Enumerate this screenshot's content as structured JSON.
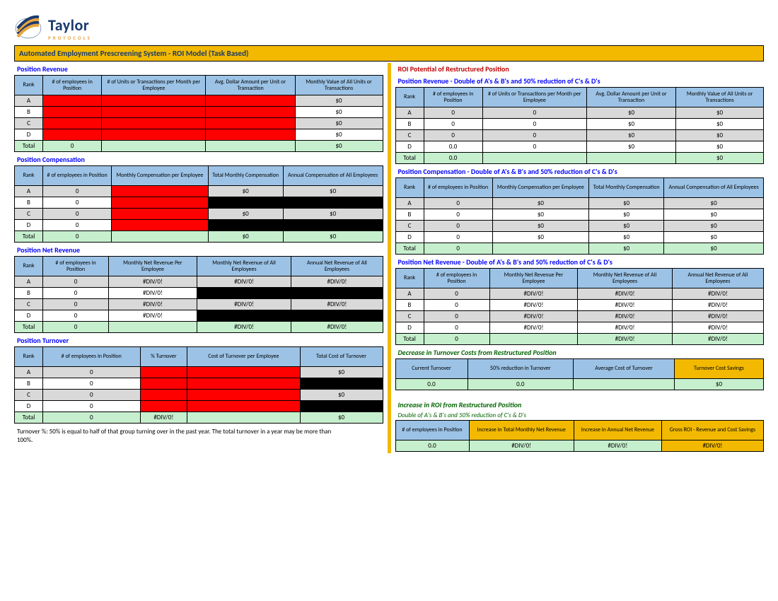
{
  "logo": {
    "name": "Taylor",
    "sub": "PROTOCOLS"
  },
  "title_bar": "Automated Employment Prescreening System - ROI Model (Task Based)",
  "ranks": [
    "A",
    "B",
    "C",
    "D"
  ],
  "total_label": "Total",
  "note": "Turnover %: 50% is equal to half of that group turning over in the past year. The total turnover in a year may be more than 100%.",
  "left": {
    "sec1": {
      "title": "Position Revenue",
      "headers": [
        "Rank",
        "# of employees in Position",
        "# of Units or Transactions per Month per Employee",
        "Avg. Dollar Amount per Unit or Transaction",
        "Monthly Value of All Units or Transactions"
      ],
      "rows": [
        [
          "A",
          "",
          "",
          "",
          "$0"
        ],
        [
          "B",
          "",
          "",
          "",
          "$0"
        ],
        [
          "C",
          "",
          "",
          "",
          "$0"
        ],
        [
          "D",
          "",
          "",
          "",
          "$0"
        ]
      ],
      "total": [
        "Total",
        "0",
        "",
        "",
        "$0"
      ]
    },
    "sec2": {
      "title": "Position Compensation",
      "headers": [
        "Rank",
        "# of employees in Position",
        "Monthly Compensation per Employee",
        "Total Monthly Compensation",
        "Annual Compensation of All Employees"
      ],
      "rows": [
        [
          "A",
          "0",
          "",
          "$0",
          "$0"
        ],
        [
          "B",
          "0",
          "",
          "",
          ""
        ],
        [
          "C",
          "0",
          "",
          "$0",
          "$0"
        ],
        [
          "D",
          "0",
          "",
          "",
          ""
        ]
      ],
      "total": [
        "Total",
        "0",
        "",
        "$0",
        "$0"
      ]
    },
    "sec3": {
      "title": "Position Net Revenue",
      "headers": [
        "Rank",
        "# of employees in Position",
        "Monthly Net Revenue Per Employee",
        "Monthly Net Revenue of All Employees",
        "Annual Net Revenue of All Employees"
      ],
      "rows": [
        [
          "A",
          "0",
          "#DIV/0!",
          "#DIV/0!",
          "#DIV/0!"
        ],
        [
          "B",
          "0",
          "#DIV/0!",
          "",
          ""
        ],
        [
          "C",
          "0",
          "#DIV/0!",
          "#DIV/0!",
          "#DIV/0!"
        ],
        [
          "D",
          "0",
          "#DIV/0!",
          "",
          ""
        ]
      ],
      "total": [
        "Total",
        "0",
        "",
        "#DIV/0!",
        "#DIV/0!"
      ]
    },
    "sec4": {
      "title": "Position Turnover",
      "headers": [
        "Rank",
        "# of employees in Position",
        "% Turnover",
        "Cost of Turnover per Employee",
        "Total Cost of Turnover"
      ],
      "rows": [
        [
          "A",
          "0",
          "",
          "",
          "$0"
        ],
        [
          "B",
          "0",
          "",
          "",
          ""
        ],
        [
          "C",
          "0",
          "",
          "",
          "$0"
        ],
        [
          "D",
          "0",
          "",
          "",
          ""
        ]
      ],
      "total": [
        "Total",
        "0",
        "#DIV/0!",
        "",
        "$0"
      ]
    }
  },
  "right": {
    "main_title": "ROI Potential of Restructured Position",
    "sec1": {
      "title": "Position Revenue - Double of A's & B's and 50% reduction of C's & D's",
      "headers": [
        "Rank",
        "# of employees in Position",
        "# of Units or Transactions per Month per Employee",
        "Avg. Dollar Amount per Unit or Transaction",
        "Monthly Value of All Units or Transactions"
      ],
      "rows": [
        [
          "A",
          "0",
          "0",
          "$0",
          "$0"
        ],
        [
          "B",
          "0",
          "0",
          "$0",
          "$0"
        ],
        [
          "C",
          "0",
          "0",
          "$0",
          "$0"
        ],
        [
          "D",
          "0.0",
          "0",
          "$0",
          "$0"
        ]
      ],
      "total": [
        "Total",
        "0.0",
        "",
        "",
        "$0"
      ]
    },
    "sec2": {
      "title": "Position Compensation - Double of A's & B's and 50% reduction of C's & D's",
      "headers": [
        "Rank",
        "# of employees in Position",
        "Monthly Compensation per Employee",
        "Total Monthly Compensation",
        "Annual Compensation of All Employees"
      ],
      "rows": [
        [
          "A",
          "0",
          "$0",
          "$0",
          "$0"
        ],
        [
          "B",
          "0",
          "$0",
          "$0",
          "$0"
        ],
        [
          "C",
          "0",
          "$0",
          "$0",
          "$0"
        ],
        [
          "D",
          "0",
          "$0",
          "$0",
          "$0"
        ]
      ],
      "total": [
        "Total",
        "0",
        "",
        "$0",
        "$0"
      ]
    },
    "sec3": {
      "title": "Position Net Revenue - Double of A's & B's and 50% reduction of C's & D's",
      "headers": [
        "Rank",
        "# of employees in Position",
        "Monthly Net Revenue Per Employee",
        "Monthly Net Revenue of All Employees",
        "Annual Net Revenue of All Employees"
      ],
      "rows": [
        [
          "A",
          "0",
          "#DIV/0!",
          "#DIV/0!",
          "#DIV/0!"
        ],
        [
          "B",
          "0",
          "#DIV/0!",
          "#DIV/0!",
          "#DIV/0!"
        ],
        [
          "C",
          "0",
          "#DIV/0!",
          "#DIV/0!",
          "#DIV/0!"
        ],
        [
          "D",
          "0",
          "#DIV/0!",
          "#DIV/0!",
          "#DIV/0!"
        ]
      ],
      "total": [
        "Total",
        "0",
        "",
        "#DIV/0!",
        "#DIV/0!"
      ]
    },
    "sec4": {
      "title": "Decrease in Turnover Costs from Restructured Position",
      "headers": [
        "Current Turnover",
        "50% reduction in Turnover",
        "Average Cost of Turnover",
        "Turnover Cost Savings"
      ],
      "row": [
        "0.0",
        "0.0",
        "",
        "$0"
      ]
    },
    "sec5": {
      "title": "Increase in ROI from Restructured Position",
      "sub": "Double of A's & B's and 50% reduction of C's & D's",
      "headers": [
        "# of employees in Position",
        "Increase in Total Monthly Net Revenue",
        "Increase in Annual Net Revenue",
        "Gross ROI - Revenue and Cost Savings"
      ],
      "row": [
        "0.0",
        "#DIV/0!",
        "#DIV/0!",
        "#DIV/0!"
      ]
    }
  }
}
